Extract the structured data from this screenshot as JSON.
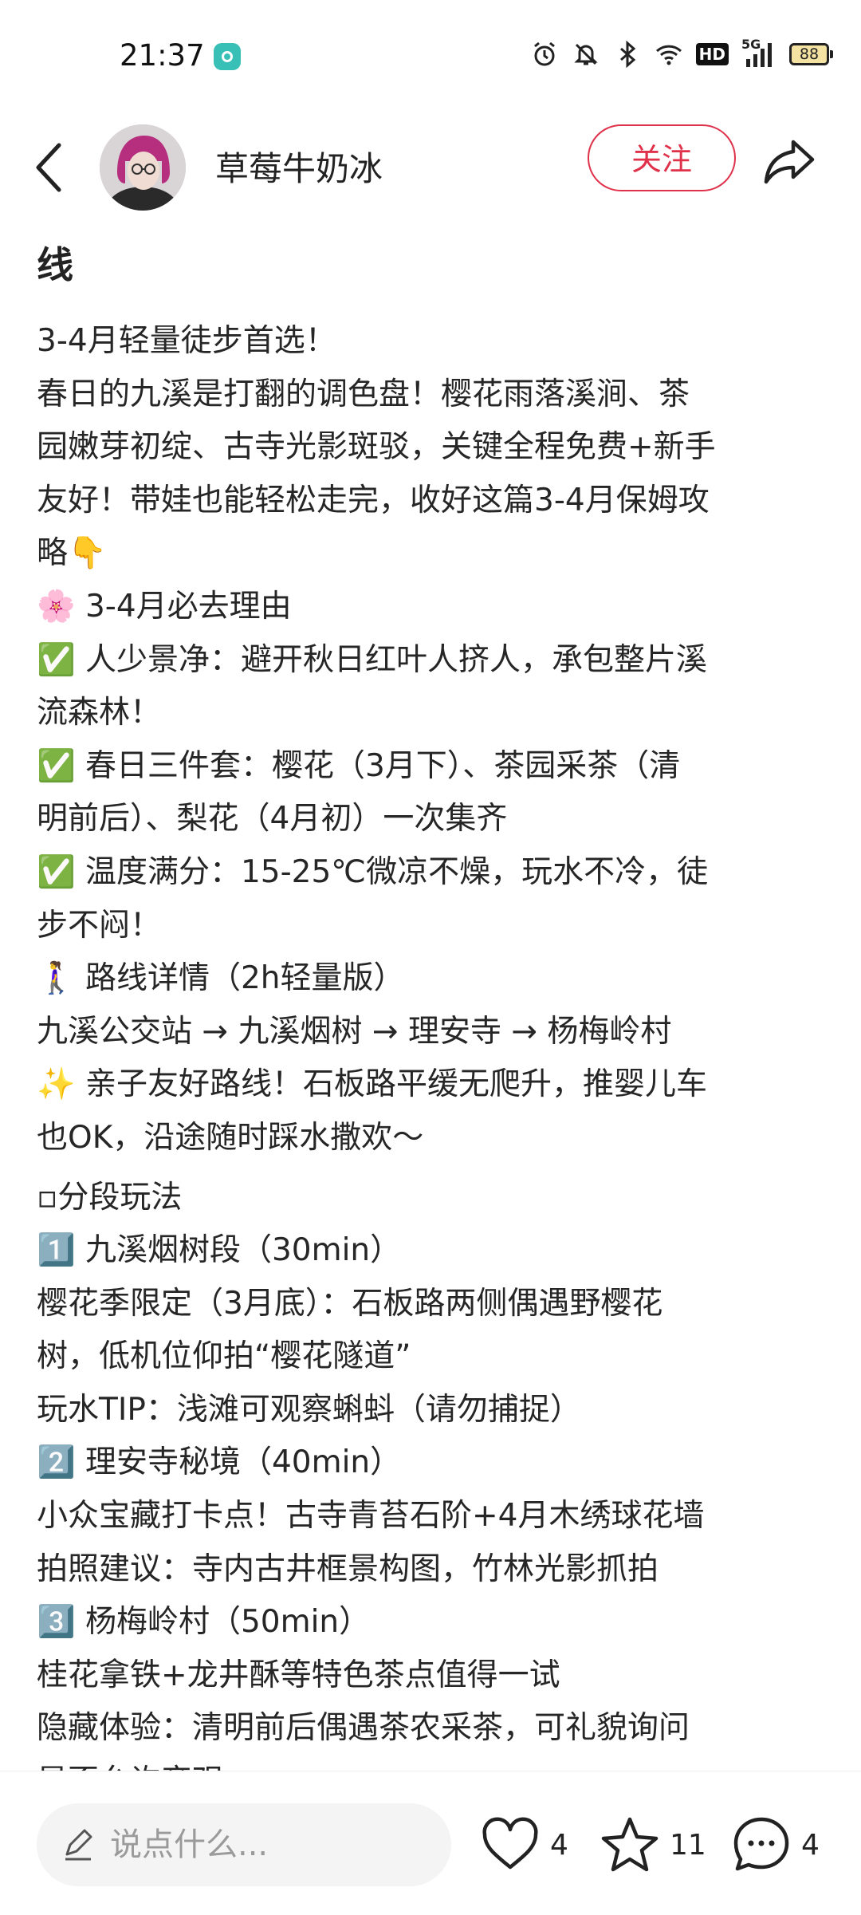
{
  "status_bar": {
    "time": "21:37",
    "network": "5G",
    "hd": "HD",
    "battery": "88",
    "icons": [
      "app-notification-icon",
      "alarm-icon",
      "mute-icon",
      "bluetooth-icon",
      "wifi-icon",
      "hd-icon",
      "signal-icon",
      "battery-icon"
    ]
  },
  "header": {
    "author": "草莓牛奶冰",
    "follow_label": "关注",
    "accent_color": "#e0314b"
  },
  "note": {
    "title_visible": "线",
    "lines": [
      "3-4月轻量徒步首选！",
      "春日的九溪是打翻的调色盘！樱花雨落溪涧、茶",
      "园嫩芽初绽、古寺光影斑驳，关键全程免费+新手",
      "友好！带娃也能轻松走完，收好这篇3-4月保姆攻",
      "略👇",
      "🌸 3-4月必去理由",
      "✅ 人少景净：避开秋日红叶人挤人，承包整片溪",
      "流森林！",
      "✅ 春日三件套：樱花（3月下）、茶园采茶（清",
      "明前后）、梨花（4月初）一次集齐",
      "✅ 温度满分：15-25℃微凉不燥，玩水不冷，徒",
      "步不闷！",
      "🚶‍♀️ 路线详情（2h轻量版）",
      "九溪公交站 → 九溪烟树 → 理安寺 → 杨梅岭村",
      "✨ 亲子友好路线！石板路平缓无爬升，推婴儿车",
      "也OK，沿途随时踩水撒欢～",
      "▫分段玩法",
      "1️⃣ 九溪烟树段（30min）",
      "樱花季限定（3月底）：石板路两侧偶遇野樱花",
      "树，低机位仰拍“樱花隧道”",
      "玩水TIP：浅滩可观察蝌蚪（请勿捕捉）",
      "2️⃣ 理安寺秘境（40min）",
      "小众宝藏打卡点！古寺青苔石阶+4月木绣球花墙",
      "拍照建议：寺内古井框景构图，竹林光影抓拍",
      "3️⃣ 杨梅岭村（50min）",
      "桂花拿铁+龙井酥等特色茶点值得一试",
      "隐藏体验：清明前后偶遇茶农采茶，可礼貌询问",
      "是否允许旁观"
    ]
  },
  "bottom_bar": {
    "comment_placeholder": "说点什么...",
    "likes": "4",
    "stars": "11",
    "comments": "4"
  }
}
